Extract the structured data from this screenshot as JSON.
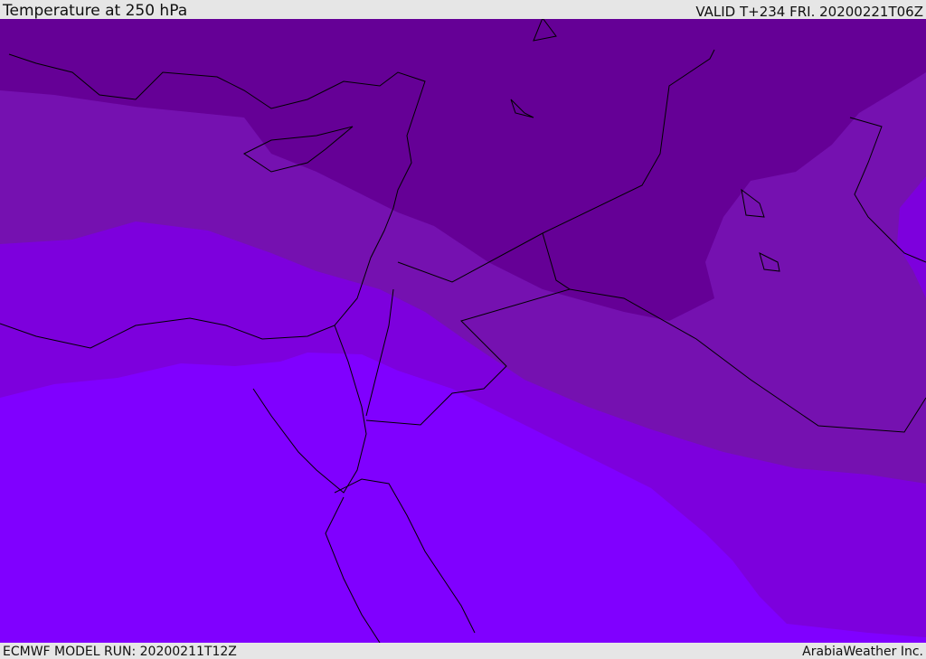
{
  "header": {
    "title": "Temperature at 250 hPa",
    "valid": "VALID T+234 FRI. 20200221T06Z"
  },
  "footer": {
    "model_run": "ECMWF MODEL RUN: 20200211T12Z",
    "brand": "ArabiaWeather Inc."
  },
  "colors": {
    "band1": "#650096",
    "band2": "#7511b0",
    "band3": "#7d00dd",
    "band4": "#8000ff",
    "coast": "#000000"
  }
}
